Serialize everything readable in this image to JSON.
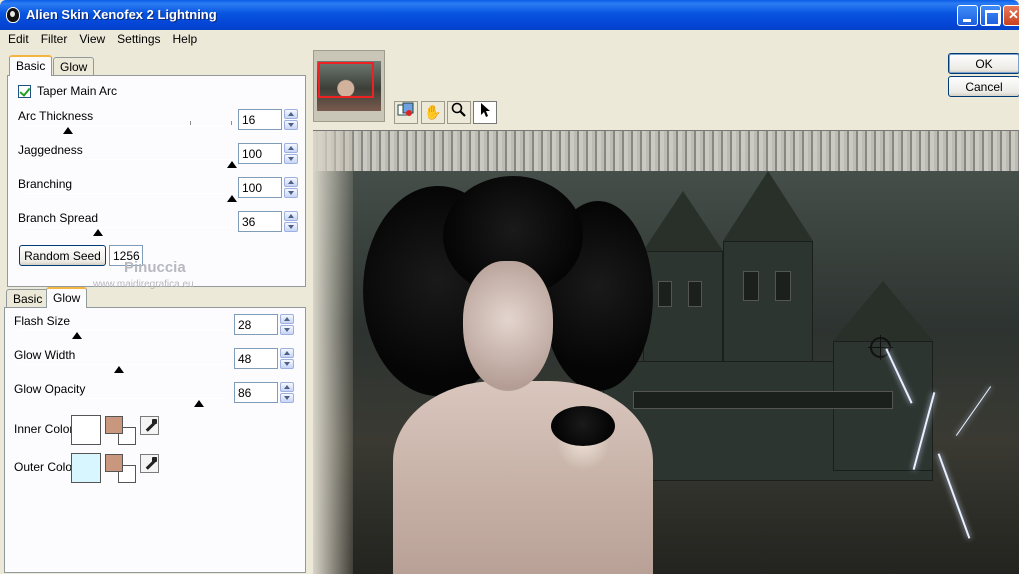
{
  "window": {
    "title": "Alien Skin Xenofex 2 Lightning"
  },
  "menu": [
    "Edit",
    "Filter",
    "View",
    "Settings",
    "Help"
  ],
  "basic_panel": {
    "tabs": [
      "Basic",
      "Glow"
    ],
    "taper_main_arc": {
      "label": "Taper Main Arc",
      "checked": true
    },
    "sliders": [
      {
        "label": "Arc Thickness",
        "value": "16",
        "fraction": 0.22
      },
      {
        "label": "Jaggedness",
        "value": "100",
        "fraction": 1.0
      },
      {
        "label": "Branching",
        "value": "100",
        "fraction": 1.0
      },
      {
        "label": "Branch Spread",
        "value": "36",
        "fraction": 0.36
      }
    ],
    "random_seed": {
      "label": "Random Seed",
      "value": "1256"
    }
  },
  "glow_panel": {
    "tabs": [
      "Basic",
      "Glow"
    ],
    "sliders": [
      {
        "label": "Flash Size",
        "value": "28",
        "fraction": 0.28
      },
      {
        "label": "Glow Width",
        "value": "48",
        "fraction": 0.48
      },
      {
        "label": "Glow Opacity",
        "value": "86",
        "fraction": 0.86
      }
    ],
    "inner_color": {
      "label": "Inner Color",
      "color": "#ffffff",
      "sample": "#c8977d"
    },
    "outer_color": {
      "label": "Outer Color",
      "color": "#d8f6ff",
      "sample": "#c8977d"
    }
  },
  "watermark": {
    "name": "Pinuccia",
    "url": "www.maidiregrafica.eu"
  },
  "toolbar": [
    "compare-icon",
    "hand-icon",
    "zoom-icon",
    "pointer-icon"
  ],
  "buttons": {
    "ok": "OK",
    "cancel": "Cancel"
  }
}
